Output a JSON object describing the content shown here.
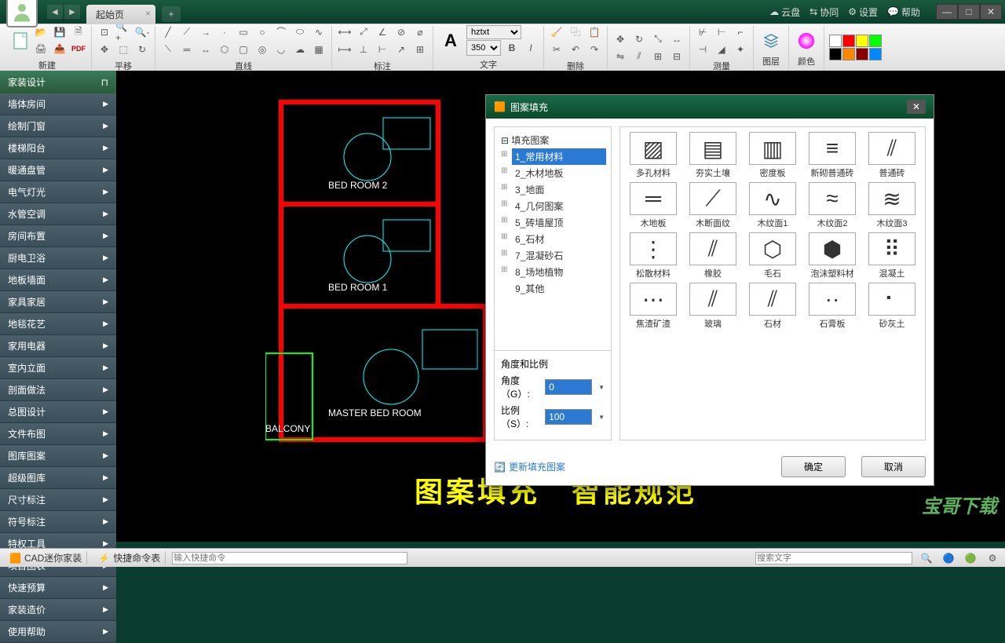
{
  "titlebar": {
    "tab_label": "起始页",
    "menu": {
      "cloud": "云盘",
      "collab": "协同",
      "settings": "设置",
      "help": "帮助"
    }
  },
  "toolbar": {
    "groups": {
      "new": "新建",
      "pan": "平移",
      "line": "直线",
      "dim": "标注",
      "text": "文字",
      "delete": "删除",
      "measure": "测量",
      "layer": "图层",
      "color": "颜色"
    },
    "font_name": "hztxt",
    "font_size": "350",
    "bold": "B",
    "italic": "I"
  },
  "sidebar": {
    "header": "家装设计",
    "items": [
      "墙体房间",
      "绘制门窗",
      "楼梯阳台",
      "暖通盘管",
      "电气灯光",
      "水管空调",
      "房间布置",
      "厨电卫浴",
      "地板墙面",
      "家具家居",
      "地毯花艺",
      "家用电器",
      "室内立面",
      "剖面做法",
      "总图设计",
      "文件布图",
      "图库图案",
      "超级图库",
      "尺寸标注",
      "符号标注",
      "特权工具",
      "项目图表",
      "快速预算",
      "家装造价",
      "使用帮助"
    ]
  },
  "canvas": {
    "rooms": {
      "r1": "BED ROOM 2",
      "r2": "BED ROOM 1",
      "r3": "MASTER BED ROOM",
      "r4": "BALCONY"
    },
    "caption": "图案填充　智能规范"
  },
  "dialog": {
    "title": "图案填充",
    "tree_root": "填充图案",
    "tree_items": [
      "1_常用材料",
      "2_木材地板",
      "3_地面",
      "4_几何图案",
      "5_砖墙屋顶",
      "6_石材",
      "7_混凝砂石",
      "8_场地植物",
      "9_其他"
    ],
    "tree_selected": 0,
    "patterns": [
      "多孔材料",
      "夯实土壤",
      "密度板",
      "新砌普通砖",
      "普通砖",
      "木地板",
      "木断面纹",
      "木纹面1",
      "木纹面2",
      "木纹面3",
      "松散材料",
      "橡胶",
      "毛石",
      "泡沫塑料材",
      "混凝土",
      "焦渣矿渣",
      "玻璃",
      "石材",
      "石膏板",
      "砂灰土"
    ],
    "angle_title": "角度和比例",
    "angle_label": "角度（G）:",
    "scale_label": "比例（S）:",
    "angle_value": "0",
    "scale_value": "100",
    "refresh": "更新填充图案",
    "ok": "确定",
    "cancel": "取消"
  },
  "statusbar": {
    "app": "CAD迷你家装",
    "shortcut": "快捷命令表",
    "cmd_placeholder": "输入快捷命令",
    "search_placeholder": "搜索文字"
  },
  "watermark": "宝哥下载",
  "colors": [
    "#fff",
    "#f00",
    "#ff0",
    "#0f0",
    "#000",
    "#f80",
    "#800",
    "#08f"
  ]
}
